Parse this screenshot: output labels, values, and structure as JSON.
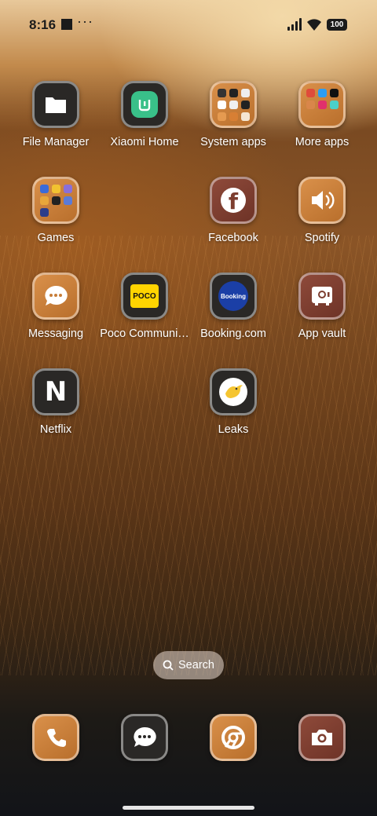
{
  "status_bar": {
    "time": "8:16",
    "overflow": "···",
    "battery": "100"
  },
  "apps": [
    {
      "id": "file-manager",
      "label": "File Manager",
      "icon": "folder-icon"
    },
    {
      "id": "xiaomi-home",
      "label": "Xiaomi Home",
      "icon": "mi-home-icon"
    },
    {
      "id": "system-apps",
      "label": "System apps",
      "icon": "folder-grid-icon"
    },
    {
      "id": "more-apps",
      "label": "More apps",
      "icon": "folder-grid-icon"
    },
    {
      "id": "games",
      "label": "Games",
      "icon": "folder-grid-icon"
    },
    {
      "id": "facebook",
      "label": "Facebook",
      "icon": "facebook-icon"
    },
    {
      "id": "spotify",
      "label": "Spotify",
      "icon": "speaker-icon"
    },
    {
      "id": "messaging",
      "label": "Messaging",
      "icon": "chat-icon"
    },
    {
      "id": "poco-community",
      "label": "Poco Communi…",
      "icon": "poco-icon",
      "icon_text": "POCO"
    },
    {
      "id": "booking",
      "label": "Booking.com",
      "icon": "booking-icon",
      "icon_text": "Booking"
    },
    {
      "id": "app-vault",
      "label": "App vault",
      "icon": "vault-icon"
    },
    {
      "id": "netflix",
      "label": "Netflix",
      "icon": "netflix-icon",
      "icon_text": "N"
    },
    {
      "id": "leaks",
      "label": "Leaks",
      "icon": "bird-icon"
    }
  ],
  "search": {
    "label": "Search"
  },
  "dock": [
    {
      "id": "phone",
      "icon": "phone-icon"
    },
    {
      "id": "messages",
      "icon": "chat-icon"
    },
    {
      "id": "browser",
      "icon": "chrome-icon"
    },
    {
      "id": "camera",
      "icon": "camera-icon"
    }
  ],
  "colors": {
    "orange_theme": "#c77d38",
    "maroon_theme": "#7d3e30",
    "dark_theme": "#2a2826"
  }
}
